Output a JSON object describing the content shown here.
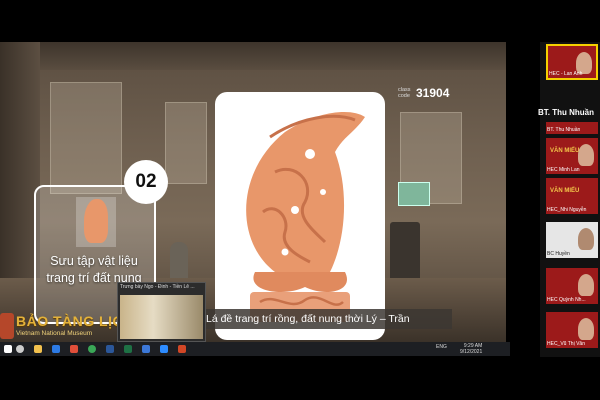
{
  "presentation": {
    "card_number": "02",
    "card_title": "Sưu tập vật liệu trang trí đất nung",
    "class_code_label": "class code",
    "class_code": "31904",
    "caption": "Lá đề trang trí rồng, đất nung thời Lý – Trần",
    "logo_main": "BẢO TÀNG LỊCH",
    "logo_sub": "Vietnam National Museum"
  },
  "thumbnail": {
    "title": "Trưng bày Ngo - Đinh - Tiền Lê ..."
  },
  "participants": {
    "section_label": "BT. Thu Nhuần",
    "tiles": [
      {
        "label": "HEC - Lan Anh",
        "active": true
      },
      {
        "label": "BT. Thu Nhuần"
      },
      {
        "label": "HEC Minh Lan"
      },
      {
        "label": "HEC_Nhi Nguyễn"
      },
      {
        "label": "BC Huyền"
      },
      {
        "label": "HEC Quỳnh Nh..."
      },
      {
        "label": "HEC_Vũ Thị Vân"
      }
    ],
    "tile_text": "VĂN MIẾU"
  },
  "taskbar": {
    "tray": "ENG",
    "time": "9:29 AM",
    "date": "9/12/2021"
  },
  "colors": {
    "tile_red": "#9c1a1a",
    "accent_yellow": "#f5d000",
    "logo_gold": "#e4b23a",
    "artifact": "#e8976a"
  }
}
